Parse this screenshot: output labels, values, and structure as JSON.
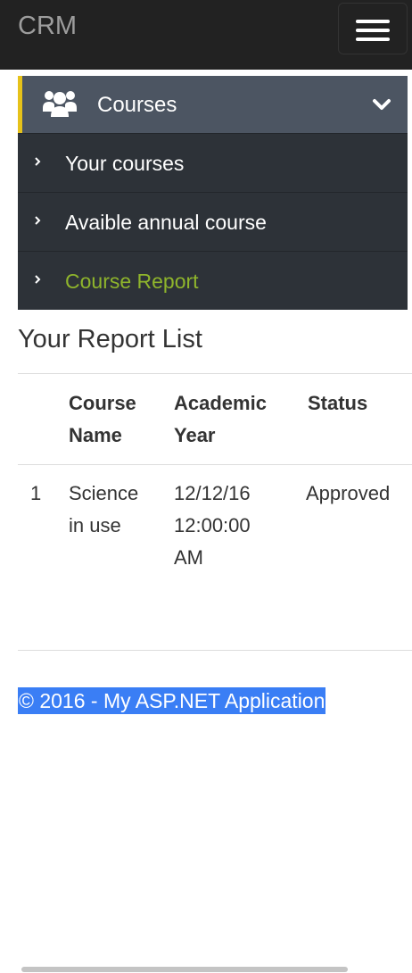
{
  "navbar": {
    "brand": "CRM",
    "toggle_icon": "hamburger-icon"
  },
  "menu": {
    "header": {
      "label": "Courses",
      "icon": "users-icon",
      "expand_icon": "chevron-down-icon",
      "accent_color": "#e6c21a"
    },
    "items": [
      {
        "label": "Your courses",
        "active": false
      },
      {
        "label": "Avaible annual course",
        "active": false
      },
      {
        "label": "Course Report",
        "active": true
      }
    ],
    "active_color": "#8fb52c"
  },
  "report": {
    "title": "Your Report List",
    "headers": {
      "course_name": [
        "Course",
        "Name"
      ],
      "academic_year": [
        "Academic",
        "Year"
      ],
      "status": "Status"
    },
    "rows": [
      {
        "index": "1",
        "course_name": [
          "Science",
          "in use"
        ],
        "academic_year": [
          "12/12/16",
          "12:00:00",
          "AM"
        ],
        "status": "Approved"
      }
    ]
  },
  "footer": {
    "text": "© 2016 - My ASP.NET Application"
  }
}
